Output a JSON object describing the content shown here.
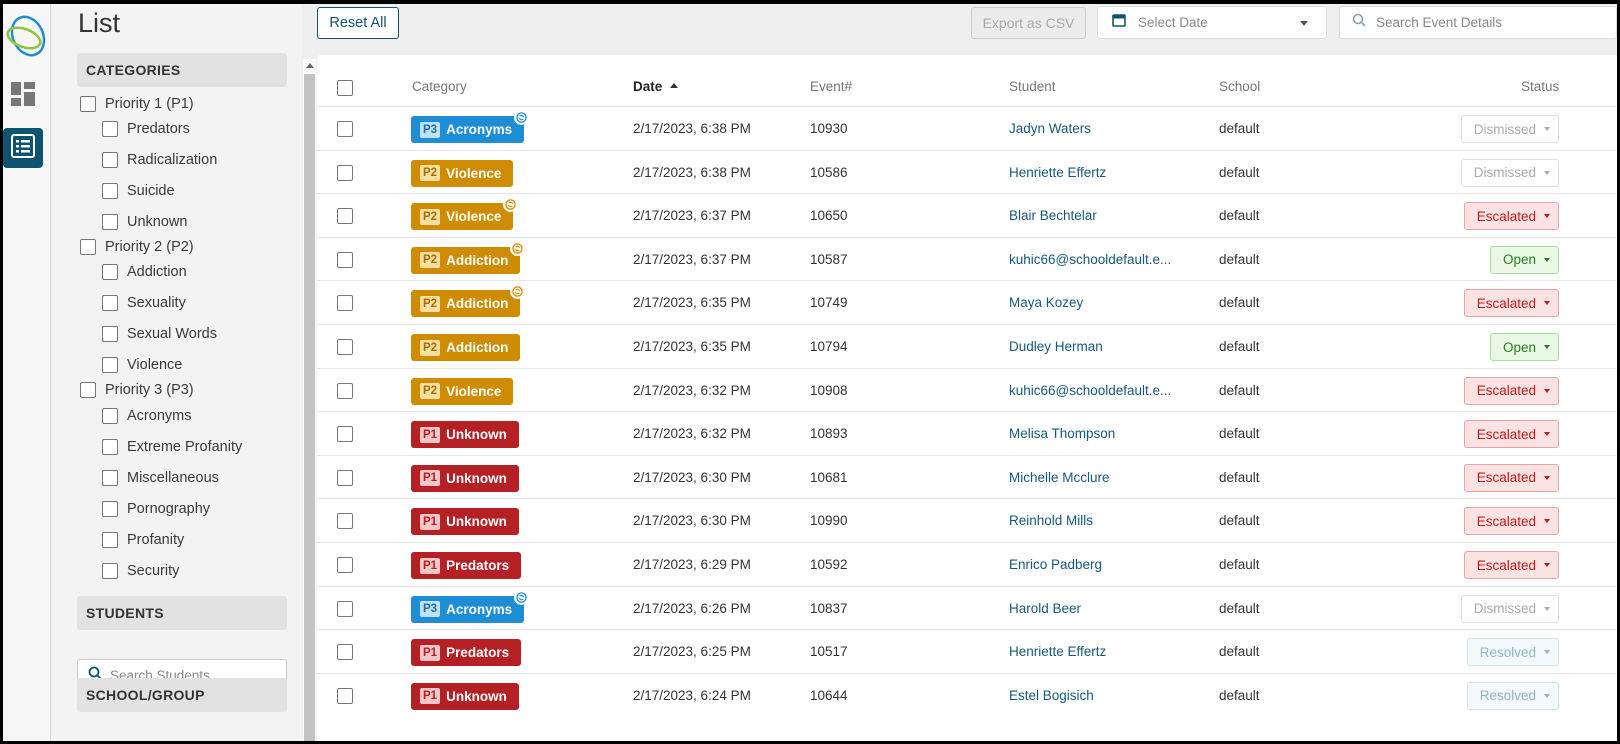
{
  "page": {
    "title": "List"
  },
  "rail": {
    "items": [
      {
        "icon": "dashboard-icon"
      },
      {
        "icon": "list-icon",
        "active": true
      }
    ]
  },
  "filters": {
    "categories_header": "CATEGORIES",
    "priorities": [
      {
        "label": "Priority 1 (P1)",
        "items": [
          "Predators",
          "Radicalization",
          "Suicide",
          "Unknown"
        ]
      },
      {
        "label": "Priority 2 (P2)",
        "items": [
          "Addiction",
          "Sexuality",
          "Sexual Words",
          "Violence"
        ]
      },
      {
        "label": "Priority 3 (P3)",
        "items": [
          "Acronyms",
          "Extreme Profanity",
          "Miscellaneous",
          "Pornography",
          "Profanity",
          "Security"
        ]
      }
    ],
    "students_header": "STUDENTS",
    "students_search_placeholder": "Search Students",
    "school_header": "SCHOOL/GROUP"
  },
  "toolbar": {
    "reset_label": "Reset All",
    "export_label": "Export as CSV",
    "date_placeholder": "Select Date",
    "search_placeholder": "Search Event Details"
  },
  "table": {
    "columns": {
      "category": "Category",
      "date": "Date",
      "event": "Event#",
      "student": "Student",
      "school": "School",
      "status": "Status"
    },
    "sort": {
      "column": "date",
      "direction": "asc"
    },
    "rows": [
      {
        "priority": "P3",
        "category": "Acronyms",
        "sync": true,
        "date": "2/17/2023, 6:38 PM",
        "event": "10930",
        "student": "Jadyn Waters",
        "school": "default",
        "status": "Dismissed"
      },
      {
        "priority": "P2",
        "category": "Violence",
        "sync": false,
        "date": "2/17/2023, 6:38 PM",
        "event": "10586",
        "student": "Henriette Effertz",
        "school": "default",
        "status": "Dismissed"
      },
      {
        "priority": "P2",
        "category": "Violence",
        "sync": true,
        "date": "2/17/2023, 6:37 PM",
        "event": "10650",
        "student": "Blair Bechtelar",
        "school": "default",
        "status": "Escalated"
      },
      {
        "priority": "P2",
        "category": "Addiction",
        "sync": true,
        "date": "2/17/2023, 6:37 PM",
        "event": "10587",
        "student": "kuhic66@schooldefault.e...",
        "school": "default",
        "status": "Open"
      },
      {
        "priority": "P2",
        "category": "Addiction",
        "sync": true,
        "date": "2/17/2023, 6:35 PM",
        "event": "10749",
        "student": "Maya Kozey",
        "school": "default",
        "status": "Escalated"
      },
      {
        "priority": "P2",
        "category": "Addiction",
        "sync": false,
        "date": "2/17/2023, 6:35 PM",
        "event": "10794",
        "student": "Dudley Herman",
        "school": "default",
        "status": "Open"
      },
      {
        "priority": "P2",
        "category": "Violence",
        "sync": false,
        "date": "2/17/2023, 6:32 PM",
        "event": "10908",
        "student": "kuhic66@schooldefault.e...",
        "school": "default",
        "status": "Escalated"
      },
      {
        "priority": "P1",
        "category": "Unknown",
        "sync": false,
        "date": "2/17/2023, 6:32 PM",
        "event": "10893",
        "student": "Melisa Thompson",
        "school": "default",
        "status": "Escalated"
      },
      {
        "priority": "P1",
        "category": "Unknown",
        "sync": false,
        "date": "2/17/2023, 6:30 PM",
        "event": "10681",
        "student": "Michelle Mcclure",
        "school": "default",
        "status": "Escalated"
      },
      {
        "priority": "P1",
        "category": "Unknown",
        "sync": false,
        "date": "2/17/2023, 6:30 PM",
        "event": "10990",
        "student": "Reinhold Mills",
        "school": "default",
        "status": "Escalated"
      },
      {
        "priority": "P1",
        "category": "Predators",
        "sync": false,
        "date": "2/17/2023, 6:29 PM",
        "event": "10592",
        "student": "Enrico Padberg",
        "school": "default",
        "status": "Escalated"
      },
      {
        "priority": "P3",
        "category": "Acronyms",
        "sync": true,
        "date": "2/17/2023, 6:26 PM",
        "event": "10837",
        "student": "Harold Beer",
        "school": "default",
        "status": "Dismissed"
      },
      {
        "priority": "P1",
        "category": "Predators",
        "sync": false,
        "date": "2/17/2023, 6:25 PM",
        "event": "10517",
        "student": "Henriette Effertz",
        "school": "default",
        "status": "Resolved"
      },
      {
        "priority": "P1",
        "category": "Unknown",
        "sync": false,
        "date": "2/17/2023, 6:24 PM",
        "event": "10644",
        "student": "Estel Bogisich",
        "school": "default",
        "status": "Resolved"
      }
    ]
  },
  "colors": {
    "brand": "#0e5470",
    "p1": "#b52024",
    "p2": "#d08c00",
    "p3": "#1d8ed6",
    "escalated": "#c01a1a",
    "open": "#2d7a23"
  }
}
